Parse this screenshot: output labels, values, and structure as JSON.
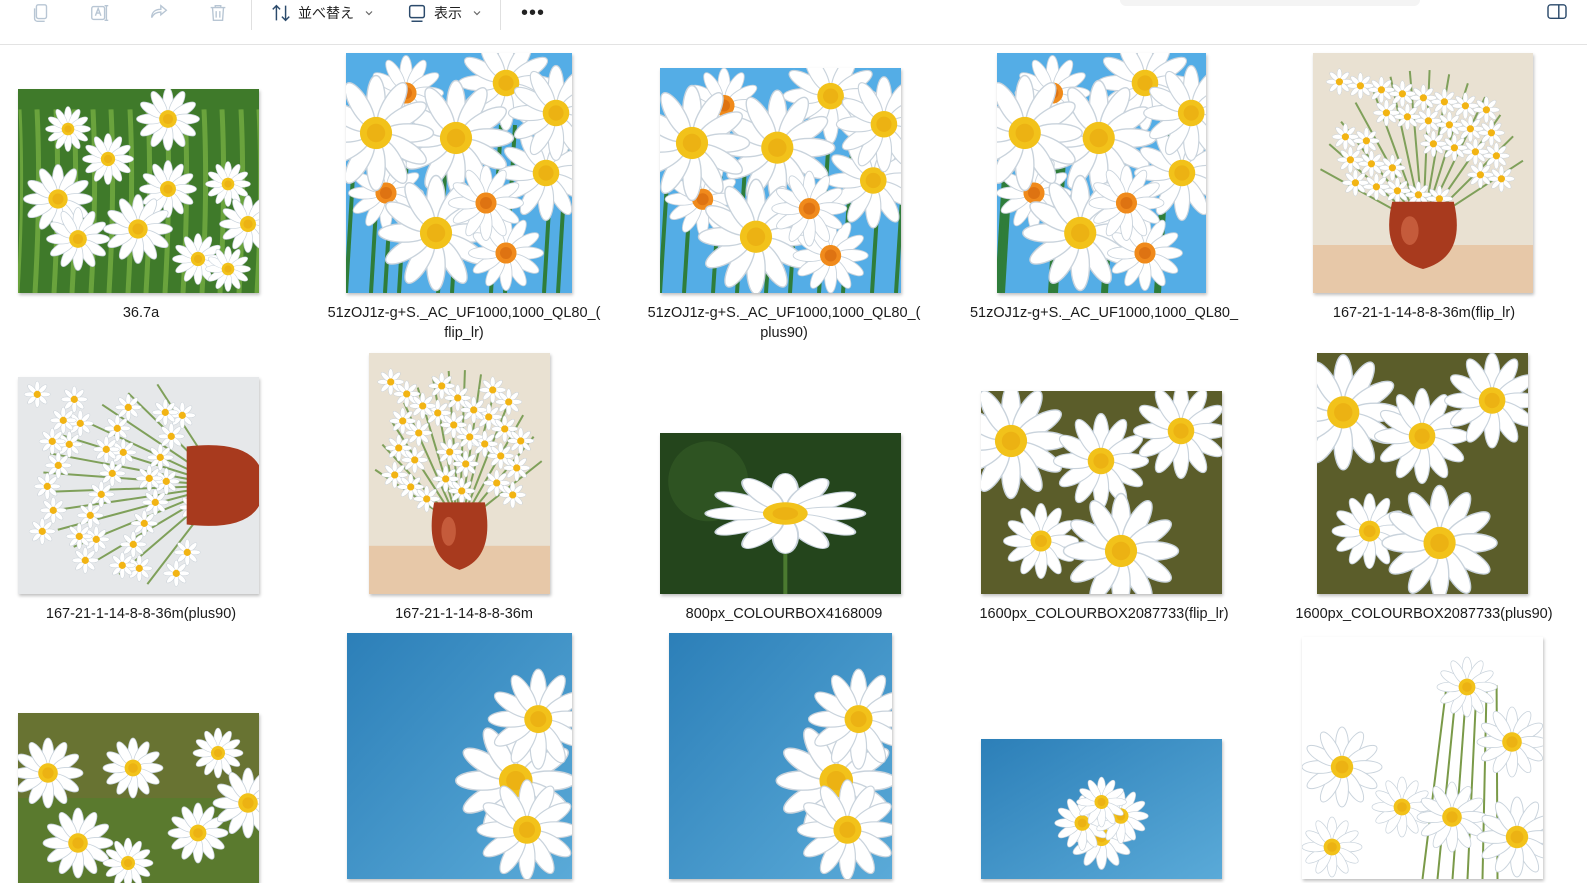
{
  "toolbar": {
    "icons": [
      "copy-icon",
      "rename-icon",
      "share-icon",
      "delete-icon"
    ],
    "sort_label": "並べ替え",
    "view_label": "表示",
    "more_label": "•••"
  },
  "files": [
    {
      "name": "36.7a",
      "art": "meadow"
    },
    {
      "name": "51zOJ1z-g+S._AC_UF1000,1000_QL80_(",
      "name2": "flip_lr)",
      "art": "painted-blue"
    },
    {
      "name": "51zOJ1z-g+S._AC_UF1000,1000_QL80_(",
      "name2": "plus90)",
      "art": "painted-blue"
    },
    {
      "name": "51zOJ1z-g+S._AC_UF1000,1000_QL80_",
      "art": "painted-blue"
    },
    {
      "name": "167-21-1-14-8-8-36m(flip_lr)",
      "art": "vase"
    },
    {
      "name": "167-21-1-14-8-8-36m(plus90)",
      "art": "vase-rot"
    },
    {
      "name": "167-21-1-14-8-8-36m",
      "art": "vase"
    },
    {
      "name": "800px_COLOURBOX4168009",
      "art": "single-daisy"
    },
    {
      "name": "1600px_COLOURBOX2087733(flip_lr)",
      "art": "daisy-bokeh"
    },
    {
      "name": "1600px_COLOURBOX2087733(plus90)",
      "art": "daisy-bokeh"
    },
    {
      "name": "",
      "art": "meadow-close"
    },
    {
      "name": "",
      "art": "sky-cluster"
    },
    {
      "name": "",
      "art": "sky-cluster"
    },
    {
      "name": "",
      "art": "sky-cluster"
    },
    {
      "name": "",
      "art": "white-daisies"
    }
  ]
}
